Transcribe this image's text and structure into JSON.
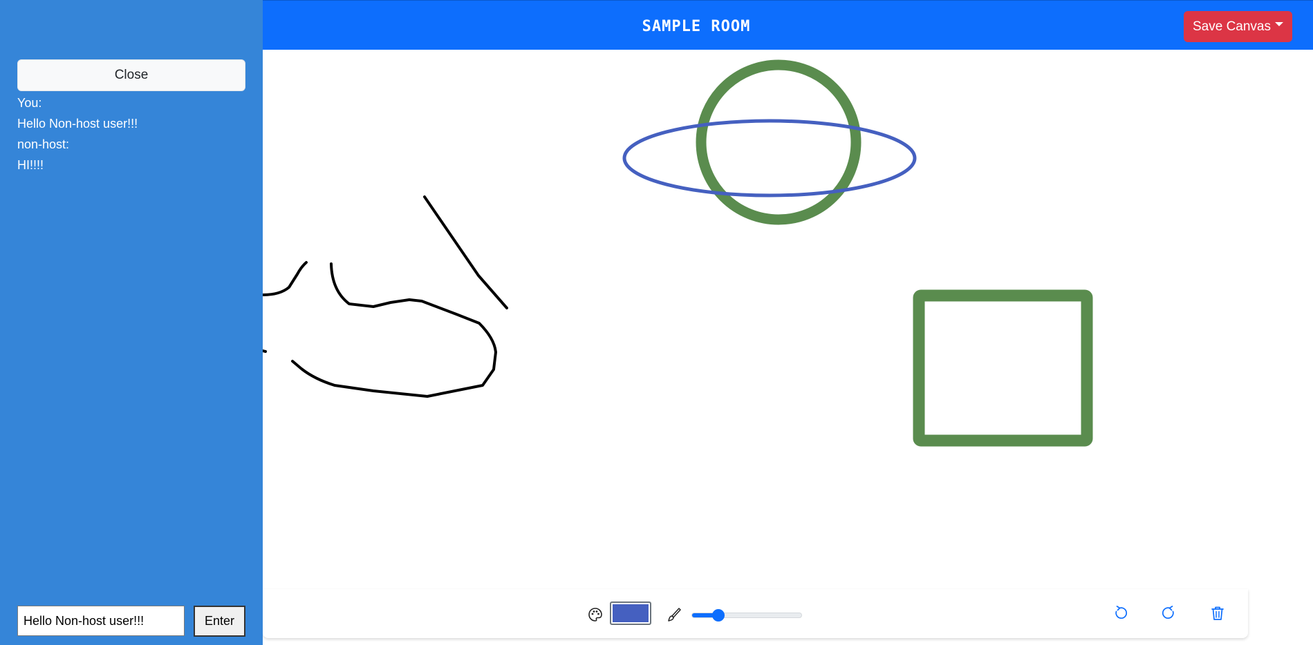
{
  "header": {
    "title": "SAMPLE ROOM",
    "save_label": "Save Canvas",
    "background_color": "#0d6efd",
    "save_color": "#dc3545"
  },
  "sidebar": {
    "close_label": "Close",
    "messages": [
      {
        "sender": "You:",
        "text": "Hello Non-host user!!!"
      },
      {
        "sender": "non-host:",
        "text": "HI!!!!"
      }
    ],
    "input_value": "Hello Non-host user!!!",
    "enter_label": "Enter",
    "background_color": "#3585d8"
  },
  "canvas": {
    "shapes": [
      {
        "kind": "circle",
        "stroke": "#5a8c4e"
      },
      {
        "kind": "ellipse",
        "stroke": "#4560c0"
      },
      {
        "kind": "rectangle",
        "stroke": "#5a8c4e"
      },
      {
        "kind": "freehand",
        "stroke": "#000000"
      }
    ]
  },
  "toolbar": {
    "palette_icon": "palette-icon",
    "selected_color": "#4560c0",
    "brush_icon": "brush-icon",
    "brush_size_fraction": 0.24,
    "undo_icon": "undo-icon",
    "redo_icon": "redo-icon",
    "clear_icon": "trash-icon",
    "accent_color": "#0d6efd"
  }
}
